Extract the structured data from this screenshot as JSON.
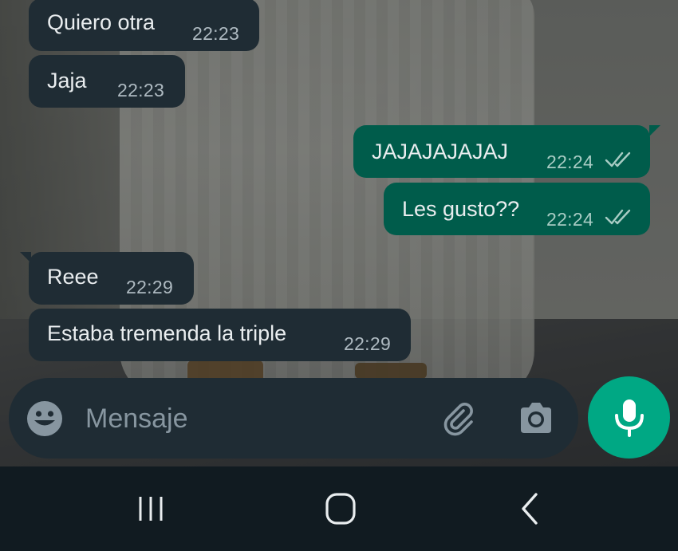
{
  "messages": [
    {
      "dir": "in",
      "text": "Quiero otra",
      "time": "22:23"
    },
    {
      "dir": "in",
      "text": "Jaja",
      "time": "22:23"
    },
    {
      "dir": "out",
      "text": "JAJAJAJAJAJ",
      "time": "22:24",
      "status": "double-check-icon"
    },
    {
      "dir": "out",
      "text": "Les gusto??",
      "time": "22:24",
      "status": "double-check-icon"
    },
    {
      "dir": "in",
      "text": "Reee",
      "time": "22:29"
    },
    {
      "dir": "in",
      "text": "Estaba tremenda la triple",
      "time": "22:29"
    }
  ],
  "composer": {
    "placeholder": "Mensaje",
    "value": "",
    "emoji_icon": "emoji-icon",
    "attach_icon": "paperclip-icon",
    "camera_icon": "camera-icon",
    "send_icon": "microphone-icon"
  },
  "navbar": {
    "recents_icon": "recents-icon",
    "home_icon": "home-icon",
    "back_icon": "back-icon"
  },
  "colors": {
    "incoming_bubble": "#1f2c34",
    "outgoing_bubble": "#005c4b",
    "accent": "#00a884",
    "navbar": "#111b21",
    "text": "#e9edef",
    "meta_text": "#aebac1"
  }
}
